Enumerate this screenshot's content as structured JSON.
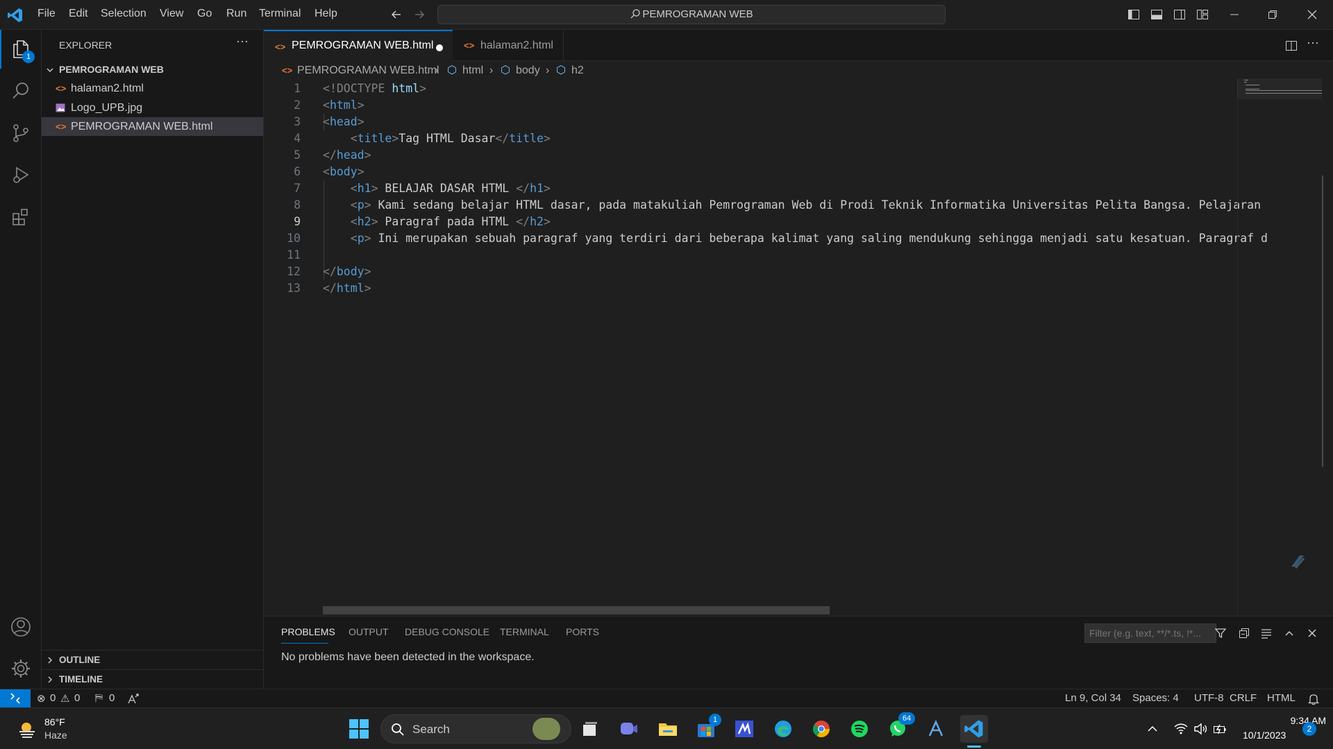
{
  "titlebar": {
    "menus": [
      "File",
      "Edit",
      "Selection",
      "View",
      "Go",
      "Run",
      "Terminal",
      "Help"
    ],
    "search": "PEMROGRAMAN WEB"
  },
  "activity": {
    "explorer_badge": "1"
  },
  "sidebar": {
    "title": "EXPLORER",
    "folder": "PEMROGRAMAN WEB",
    "files": [
      "halaman2.html",
      "Logo_UPB.jpg",
      "PEMROGRAMAN WEB.html"
    ],
    "outline": "OUTLINE",
    "timeline": "TIMELINE"
  },
  "tabs": [
    {
      "label": "PEMROGRAMAN WEB.html"
    },
    {
      "label": "halaman2.html"
    }
  ],
  "breadcrumb": {
    "file": "PEMROGRAMAN WEB.html",
    "items": [
      "html",
      "body",
      "h2"
    ]
  },
  "editor": {
    "line_numbers": [
      "1",
      "2",
      "3",
      "4",
      "5",
      "6",
      "7",
      "8",
      "9",
      "10",
      "11",
      "12",
      "13"
    ],
    "l1_text": "!DOCTYPE",
    "l1_kw": "html",
    "l4_text": "Tag HTML Dasar",
    "l7_text": " BELAJAR DASAR HTML ",
    "l8_text": " Kami sedang belajar HTML dasar, pada matakuliah Pemrograman Web di Prodi Teknik Informatika Universitas Pelita Bangsa. Pelajaran",
    "l9_text": " Paragraf pada HTML ",
    "l10_text": " Ini merupakan sebuah paragraf yang terdiri dari beberapa kalimat yang saling mendukung sehingga menjadi satu kesatuan. Paragraf d",
    "tags": {
      "html": "html",
      "head": "head",
      "title": "title",
      "body": "body",
      "h1": "h1",
      "p": "p",
      "h2": "h2"
    }
  },
  "panel": {
    "tabs": [
      "PROBLEMS",
      "OUTPUT",
      "DEBUG CONSOLE",
      "TERMINAL",
      "PORTS"
    ],
    "filter_placeholder": "Filter (e.g. text, **/*.ts, !*...",
    "message": "No problems have been detected in the workspace."
  },
  "statusbar": {
    "errors": "0",
    "warnings": "0",
    "ports": "0",
    "position": "Ln 9, Col 34",
    "spaces": "Spaces: 4",
    "encoding": "UTF-8",
    "eol": "CRLF",
    "language": "HTML"
  },
  "taskbar": {
    "weather_temp": "86°F",
    "weather_desc": "Haze",
    "search": "Search",
    "store_badge": "1",
    "whatsapp_badge": "64",
    "time": "9:34 AM",
    "date": "10/1/2023",
    "notification_count": "2"
  },
  "colors": {
    "accent": "#0078d4",
    "tag": "#569cd6",
    "modified_dot": "#ffffff"
  }
}
